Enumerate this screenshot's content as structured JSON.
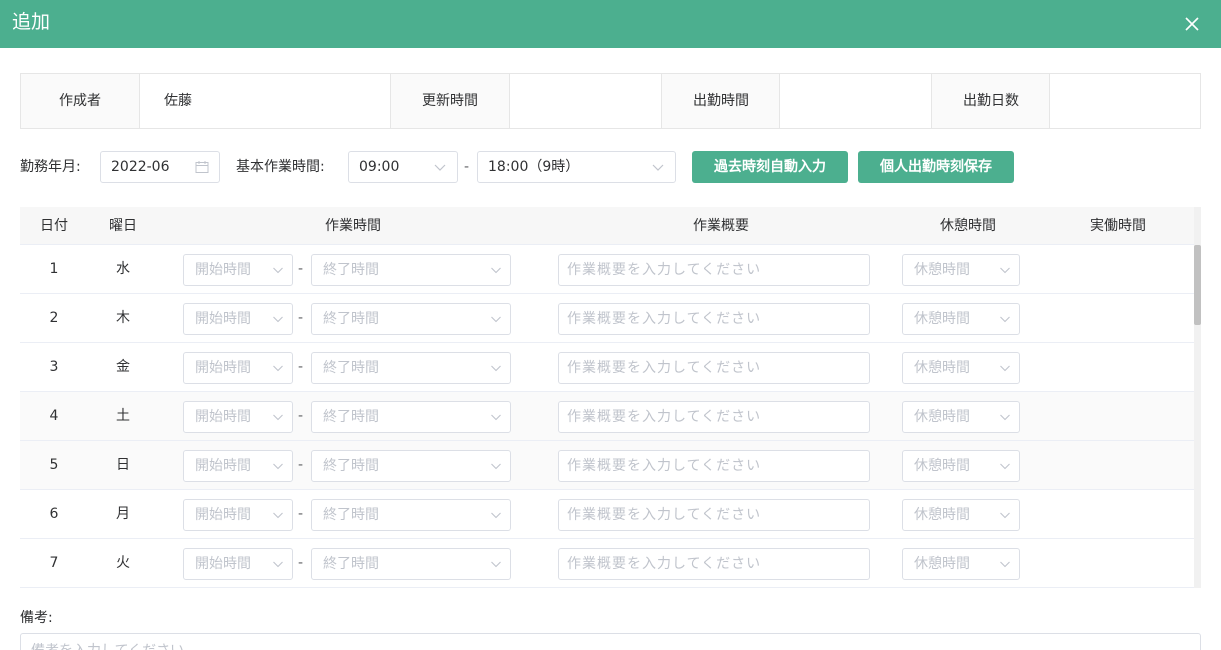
{
  "dialog": {
    "title": "追加",
    "header_color": "#4caf8f"
  },
  "info": {
    "creator_label": "作成者",
    "creator_value": "佐藤",
    "updated_label": "更新時間",
    "updated_value": "",
    "work_hours_label": "出勤時間",
    "work_hours_value": "",
    "work_days_label": "出勤日数",
    "work_days_value": ""
  },
  "filters": {
    "month_label": "勤務年月:",
    "month_value": "2022-06",
    "base_time_label": "基本作業時間:",
    "start_value": "09:00",
    "dash": "-",
    "end_value": "18:00（9時）",
    "auto_fill_button": "過去時刻自動入力",
    "save_button": "個人出勤時刻保存"
  },
  "table": {
    "headers": {
      "date": "日付",
      "weekday": "曜日",
      "work_time": "作業時間",
      "summary": "作業概要",
      "break_time": "休憩時間",
      "actual_time": "実働時間"
    },
    "start_placeholder": "開始時間",
    "end_placeholder": "終了時間",
    "summary_placeholder": "作業概要を入力してください",
    "break_placeholder": "休憩時間",
    "dash": "-",
    "rows": [
      {
        "day": "1",
        "weekday": "水"
      },
      {
        "day": "2",
        "weekday": "木"
      },
      {
        "day": "3",
        "weekday": "金"
      },
      {
        "day": "4",
        "weekday": "土"
      },
      {
        "day": "5",
        "weekday": "日"
      },
      {
        "day": "6",
        "weekday": "月"
      },
      {
        "day": "7",
        "weekday": "火"
      }
    ]
  },
  "remarks": {
    "label": "備考:",
    "placeholder": "備考を入力してください"
  }
}
